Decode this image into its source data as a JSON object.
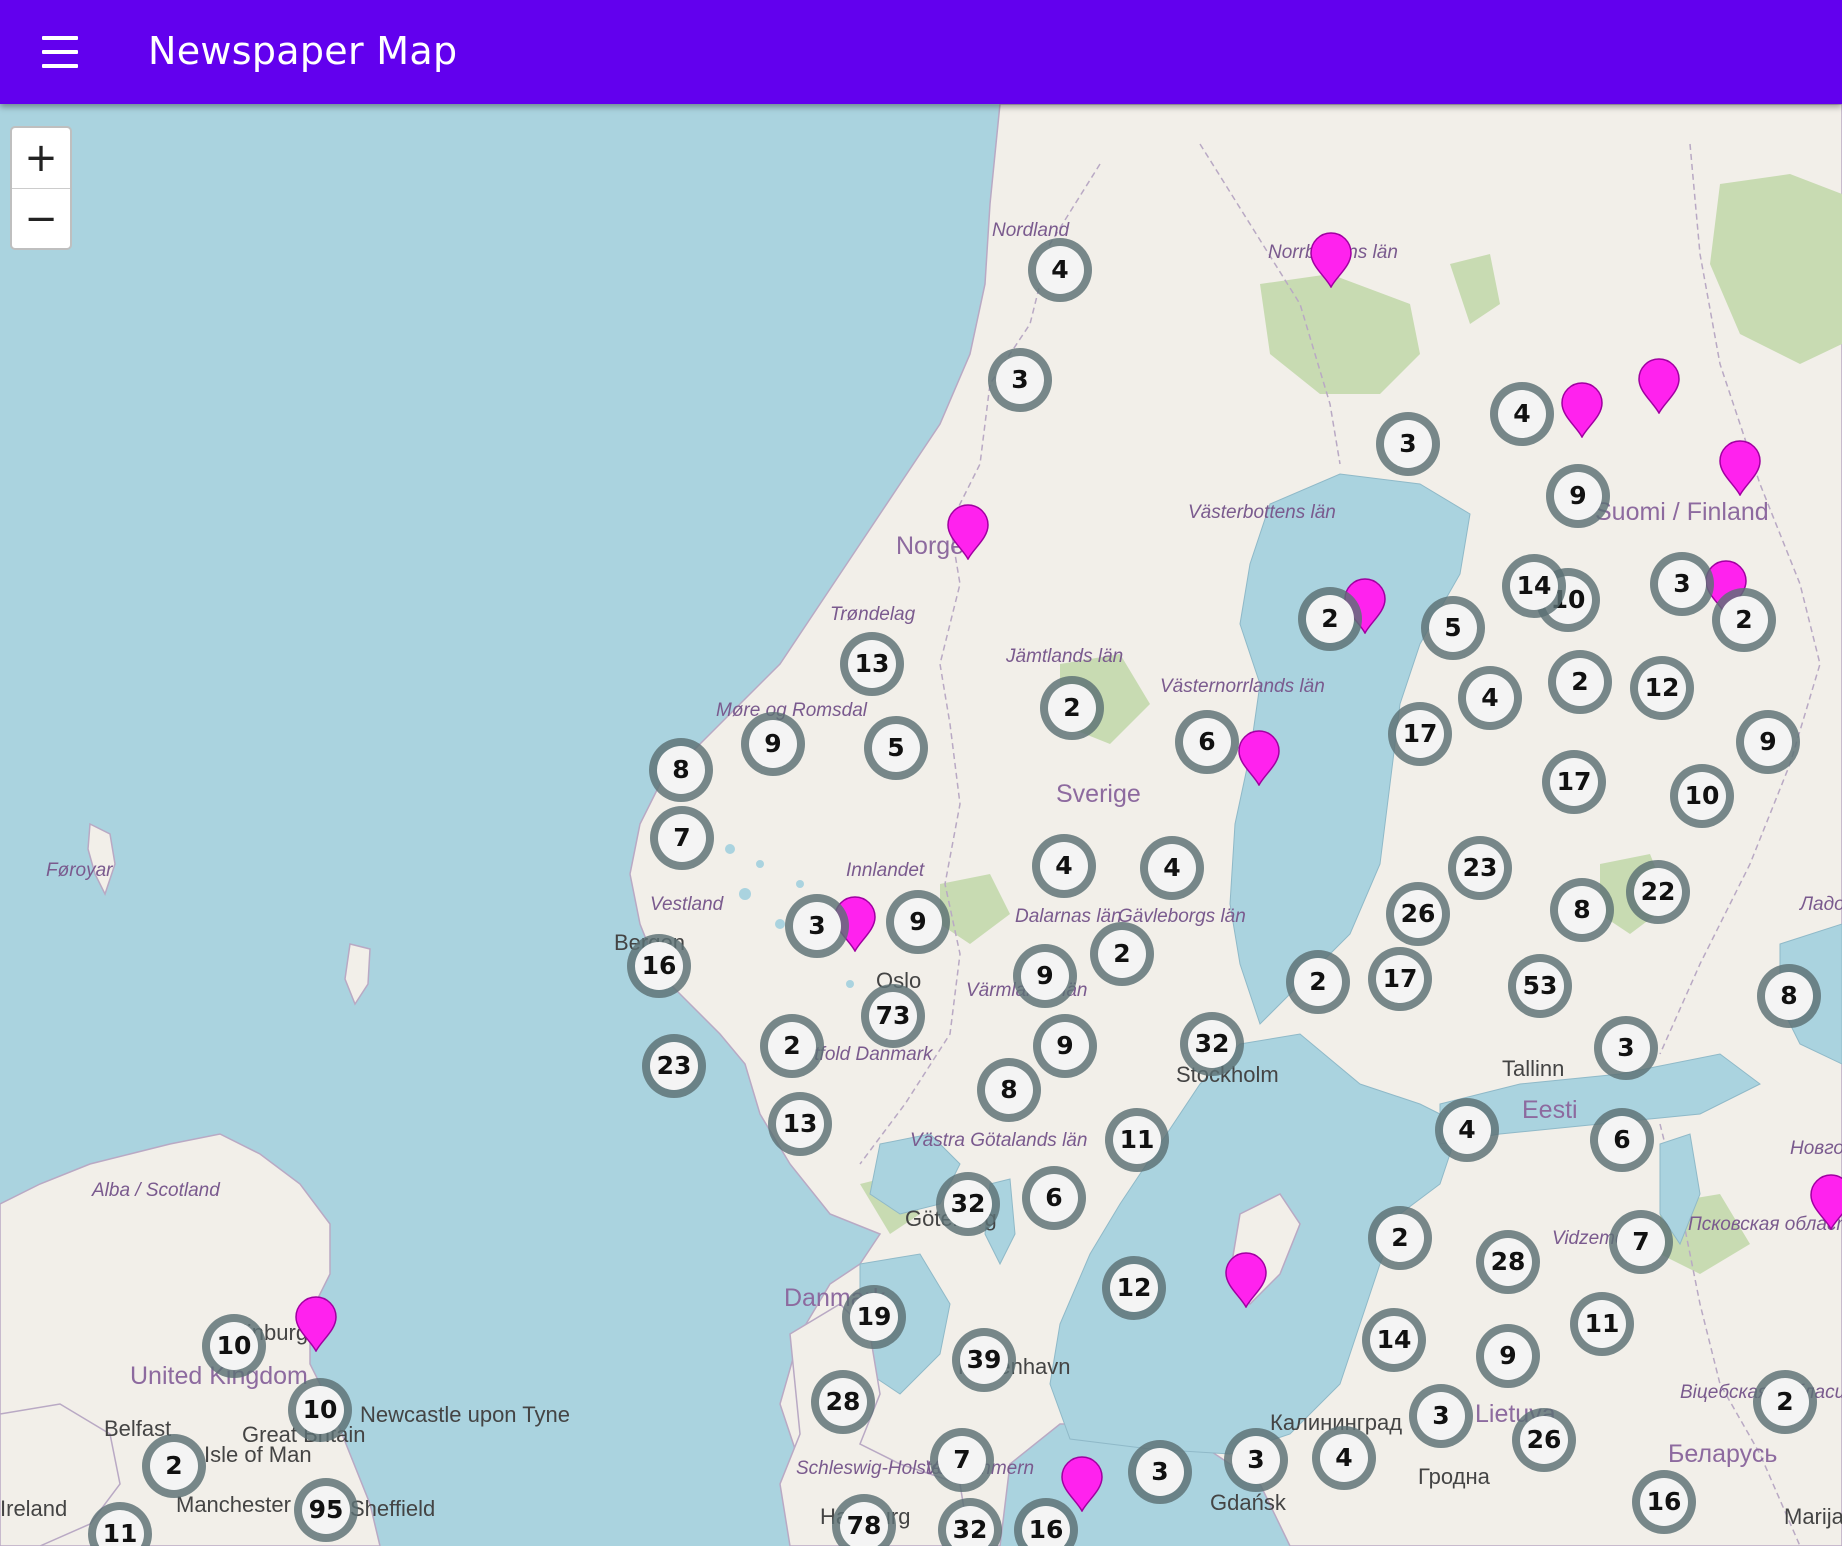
{
  "app": {
    "title": "Newspaper Map"
  },
  "zoom": {
    "in_label": "+",
    "out_label": "−"
  },
  "colors": {
    "appbar": "#6200ee",
    "water": "#aad3df",
    "land": "#f2efe9",
    "forest": "#c8dbb2",
    "marker": "#ff22ee",
    "cluster_ring": "#5c7074"
  },
  "labels": [
    {
      "text": "Nordland"
    },
    {
      "text": "Norrbottens län"
    },
    {
      "text": "Västerbottens län"
    },
    {
      "text": "Suomi / Finland"
    },
    {
      "text": "Norge"
    },
    {
      "text": "Trøndelag"
    },
    {
      "text": "Jämtlands län"
    },
    {
      "text": "Västernorrlands län"
    },
    {
      "text": "Møre og Romsdal"
    },
    {
      "text": "Sverige"
    },
    {
      "text": "Innlandet"
    },
    {
      "text": "Vestland"
    },
    {
      "text": "Bergen"
    },
    {
      "text": "Oslo"
    },
    {
      "text": "Värmlands län"
    },
    {
      "text": "Stockholm"
    },
    {
      "text": "Tallinn"
    },
    {
      "text": "Eesti"
    },
    {
      "text": "Västra Götalands län"
    },
    {
      "text": "Göteborg"
    },
    {
      "text": "Alba / Scotland"
    },
    {
      "text": "Edinburgh"
    },
    {
      "text": "United Kingdom"
    },
    {
      "text": "Newcastle upon Tyne"
    },
    {
      "text": "Great Britain"
    },
    {
      "text": "Belfast"
    },
    {
      "text": "Isle of Man"
    },
    {
      "text": "Danmark"
    },
    {
      "text": "København"
    },
    {
      "text": "Schleswig-Holstein"
    },
    {
      "text": "Калининград"
    },
    {
      "text": "Lietuva"
    },
    {
      "text": "Гродна"
    },
    {
      "text": "Псковская область"
    },
    {
      "text": "Vidzeme"
    },
    {
      "text": "Manchester"
    },
    {
      "text": "Sheffield"
    },
    {
      "text": "Føroyar"
    },
    {
      "text": "Ireland"
    },
    {
      "text": "Новгородская область"
    },
    {
      "text": "Ладожское озеро"
    },
    {
      "text": "Віцебская вобласць"
    },
    {
      "text": "Беларусь"
    },
    {
      "text": "Marijampolė"
    },
    {
      "text": "Gdańsk"
    },
    {
      "text": "Hamburg"
    },
    {
      "text": "Vorpommern"
    },
    {
      "text": "Dalarnas län"
    },
    {
      "text": "Gävleborgs län"
    },
    {
      "text": "Østfold Danmark"
    }
  ],
  "clusters": [
    {
      "count": "4"
    },
    {
      "count": "3"
    },
    {
      "count": "4"
    },
    {
      "count": "3"
    },
    {
      "count": "9"
    },
    {
      "count": "10"
    },
    {
      "count": "14"
    },
    {
      "count": "3"
    },
    {
      "count": "2"
    },
    {
      "count": "5"
    },
    {
      "count": "2"
    },
    {
      "count": "13"
    },
    {
      "count": "2"
    },
    {
      "count": "12"
    },
    {
      "count": "4"
    },
    {
      "count": "17"
    },
    {
      "count": "2"
    },
    {
      "count": "6"
    },
    {
      "count": "9"
    },
    {
      "count": "8"
    },
    {
      "count": "9"
    },
    {
      "count": "5"
    },
    {
      "count": "17"
    },
    {
      "count": "10"
    },
    {
      "count": "7"
    },
    {
      "count": "4"
    },
    {
      "count": "23"
    },
    {
      "count": "4"
    },
    {
      "count": "9"
    },
    {
      "count": "26"
    },
    {
      "count": "8"
    },
    {
      "count": "22"
    },
    {
      "count": "3"
    },
    {
      "count": "9"
    },
    {
      "count": "2"
    },
    {
      "count": "16"
    },
    {
      "count": "17"
    },
    {
      "count": "2"
    },
    {
      "count": "53"
    },
    {
      "count": "8"
    },
    {
      "count": "73"
    },
    {
      "count": "2"
    },
    {
      "count": "9"
    },
    {
      "count": "32"
    },
    {
      "count": "3"
    },
    {
      "count": "23"
    },
    {
      "count": "8"
    },
    {
      "count": "13"
    },
    {
      "count": "11"
    },
    {
      "count": "4"
    },
    {
      "count": "6"
    },
    {
      "count": "32"
    },
    {
      "count": "6"
    },
    {
      "count": "2"
    },
    {
      "count": "28"
    },
    {
      "count": "7"
    },
    {
      "count": "12"
    },
    {
      "count": "19"
    },
    {
      "count": "10"
    },
    {
      "count": "14"
    },
    {
      "count": "9"
    },
    {
      "count": "11"
    },
    {
      "count": "39"
    },
    {
      "count": "10"
    },
    {
      "count": "28"
    },
    {
      "count": "3"
    },
    {
      "count": "26"
    },
    {
      "count": "2"
    },
    {
      "count": "2"
    },
    {
      "count": "7"
    },
    {
      "count": "3"
    },
    {
      "count": "3"
    },
    {
      "count": "4"
    },
    {
      "count": "95"
    },
    {
      "count": "78"
    },
    {
      "count": "32"
    },
    {
      "count": "16"
    },
    {
      "count": "16"
    },
    {
      "count": "11"
    }
  ],
  "markers": [
    {
      "name": "marker"
    },
    {
      "name": "marker"
    },
    {
      "name": "marker"
    },
    {
      "name": "marker"
    },
    {
      "name": "marker"
    },
    {
      "name": "marker"
    },
    {
      "name": "marker"
    },
    {
      "name": "marker"
    },
    {
      "name": "marker"
    },
    {
      "name": "marker"
    },
    {
      "name": "marker"
    },
    {
      "name": "marker"
    },
    {
      "name": "marker"
    }
  ]
}
